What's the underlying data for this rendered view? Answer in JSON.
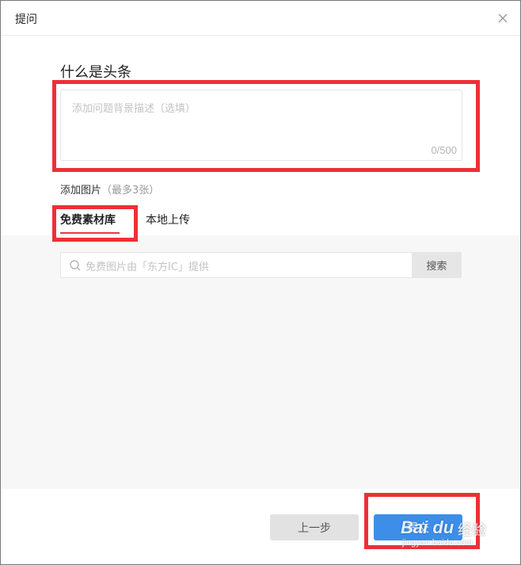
{
  "dialog": {
    "title": "提问",
    "close_icon": "close-icon"
  },
  "question": {
    "title": "什么是头条",
    "description_placeholder": "添加问题背景描述（选填）",
    "char_counter": "0/500"
  },
  "images": {
    "label": "添加图片",
    "hint": "（最多3张）",
    "tabs": [
      {
        "label": "免费素材库",
        "active": true
      },
      {
        "label": "本地上传",
        "active": false
      }
    ],
    "search": {
      "placeholder": "免费图片由「东方IC」提供",
      "button_label": "搜索",
      "icon": "search-icon"
    }
  },
  "footer": {
    "prev_label": "上一步",
    "submit_label": "提交"
  },
  "watermark": {
    "brand": "Bai du",
    "cn": "经验",
    "url": "jingyan.baidu.com"
  },
  "colors": {
    "accent_red": "#e8393b",
    "highlight_red": "#ef2f36",
    "submit_blue": "#3d8ee9",
    "panel_bg": "#f7f7f7"
  }
}
